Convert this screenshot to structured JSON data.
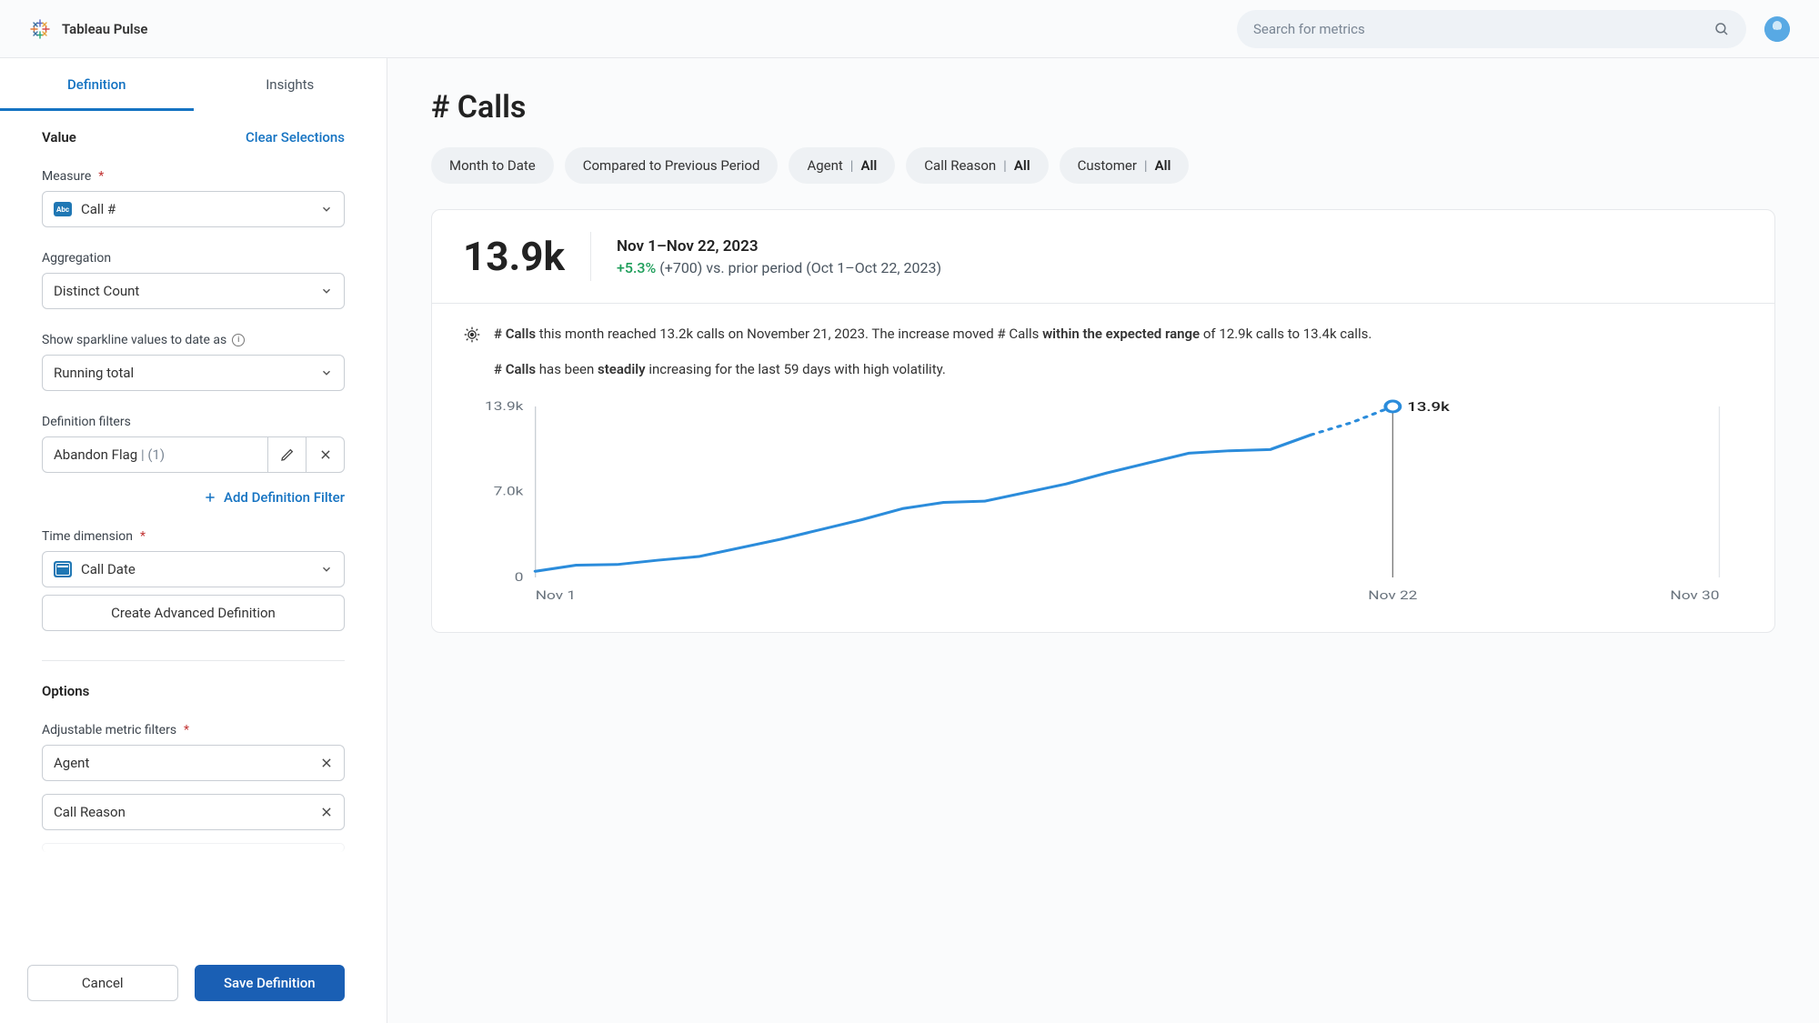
{
  "header": {
    "brand": "Tableau Pulse",
    "search_placeholder": "Search for metrics"
  },
  "sidebar": {
    "tabs": {
      "definition": "Definition",
      "insights": "Insights"
    },
    "value_section_label": "Value",
    "clear_selections": "Clear Selections",
    "measure_label": "Measure",
    "measure_value": "Call #",
    "aggregation_label": "Aggregation",
    "aggregation_value": "Distinct Count",
    "sparkline_label": "Show sparkline values to date as",
    "sparkline_value": "Running total",
    "definition_filters_label": "Definition filters",
    "definition_filter": {
      "name": "Abandon Flag",
      "count": "(1)"
    },
    "add_definition_filter": "Add Definition Filter",
    "time_dimension_label": "Time dimension",
    "time_dimension_value": "Call Date",
    "create_advanced": "Create Advanced Definition",
    "options_label": "Options",
    "adjustable_filters_label": "Adjustable metric filters",
    "adjustable_filters": [
      "Agent",
      "Call Reason"
    ],
    "footer": {
      "cancel": "Cancel",
      "save": "Save Definition"
    }
  },
  "main": {
    "title": "# Calls",
    "chips": [
      {
        "type": "single",
        "label": "Month to Date"
      },
      {
        "type": "single",
        "label": "Compared to Previous Period"
      },
      {
        "type": "pair",
        "label": "Agent",
        "value": "All"
      },
      {
        "type": "pair",
        "label": "Call Reason",
        "value": "All"
      },
      {
        "type": "pair",
        "label": "Customer",
        "value": "All"
      }
    ],
    "kpi": {
      "value": "13.9k",
      "range": "Nov 1–Nov 22, 2023",
      "delta_positive": "+5.3%",
      "delta_rest": " (+700) vs. prior period (Oct 1–Oct 22, 2023)"
    },
    "insight_main": {
      "pre": "# Calls",
      "mid1": " this month reached 13.2k calls on November 21, 2023. The increase moved # Calls ",
      "bold": "within the expected range",
      "mid2": " of 12.9k calls to 13.4k calls."
    },
    "insight_secondary": {
      "pre": "# Calls",
      "mid1": " has been ",
      "bold": "steadily",
      "mid2": " increasing for the last 59 days with high volatility."
    },
    "chart": {
      "y_ticks": [
        "13.9k",
        "7.0k",
        "0"
      ],
      "x_ticks": [
        "Nov 1",
        "Nov 22",
        "Nov 30"
      ],
      "point_label": "13.9k"
    }
  },
  "chart_data": {
    "type": "line",
    "title": "# Calls (running total, month to date)",
    "xlabel": "",
    "ylabel": "",
    "ylim": [
      0,
      13900
    ],
    "x": [
      1,
      2,
      3,
      4,
      5,
      6,
      7,
      8,
      9,
      10,
      11,
      12,
      13,
      14,
      15,
      16,
      17,
      18,
      19,
      20,
      21,
      22
    ],
    "values": [
      500,
      1000,
      1050,
      1400,
      1700,
      2400,
      3100,
      3900,
      4700,
      5600,
      6100,
      6200,
      6900,
      7600,
      8500,
      9300,
      10100,
      10300,
      10400,
      11600,
      12600,
      13900
    ],
    "series": [
      {
        "name": "solid",
        "end_index": 19
      },
      {
        "name": "dotted_projection",
        "start_index": 19
      }
    ],
    "x_tick_positions": {
      "Nov 1": 1,
      "Nov 22": 22,
      "Nov 30": 30
    },
    "current_point": {
      "x": 22,
      "y": 13900,
      "label": "13.9k"
    }
  }
}
